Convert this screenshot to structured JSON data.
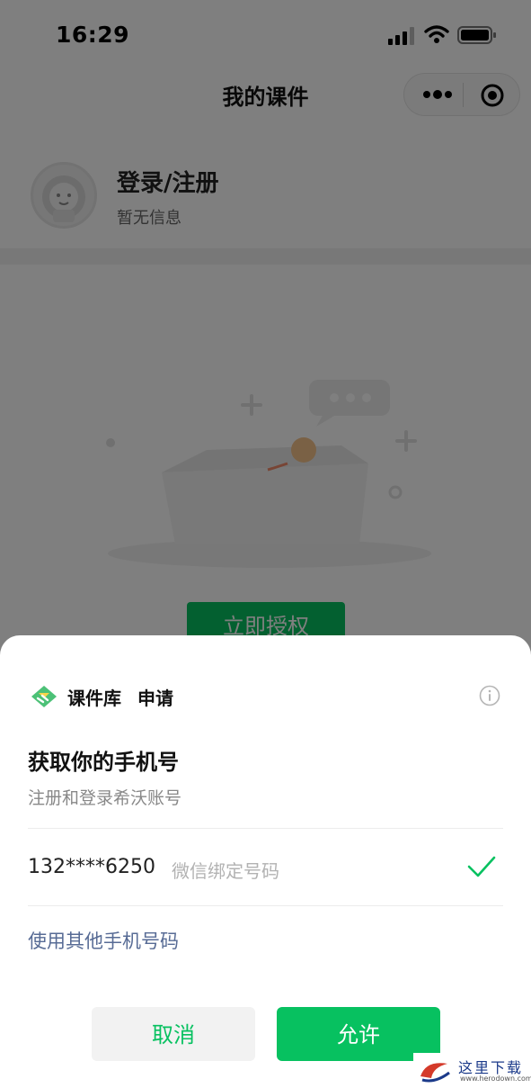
{
  "status_bar": {
    "time": "16:29"
  },
  "nav": {
    "title": "我的课件",
    "icons": [
      "more-icon",
      "close-mini-program-icon"
    ]
  },
  "profile": {
    "login_text": "登录/注册",
    "info_text": "暂无信息"
  },
  "page": {
    "authorize_label": "立即授权"
  },
  "sheet": {
    "app_name": "课件库",
    "request_label": "申请",
    "title": "获取你的手机号",
    "description": "注册和登录希沃账号",
    "phone": {
      "number": "132****6250",
      "note": "微信绑定号码",
      "selected": true
    },
    "other_phone_label": "使用其他手机号码",
    "cancel_label": "取消",
    "allow_label": "允许"
  },
  "watermark": {
    "text": "这里下载",
    "url": "www.herodown.com"
  },
  "colors": {
    "accent": "#07c160",
    "link": "#576b95",
    "mask": "rgba(0,0,0,0.5)"
  }
}
